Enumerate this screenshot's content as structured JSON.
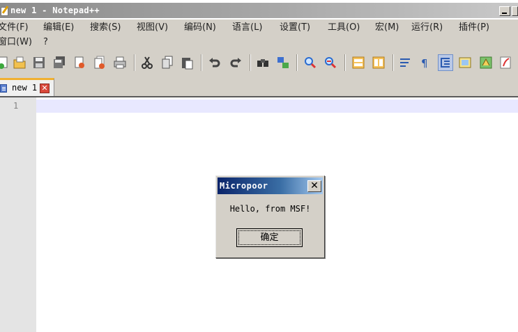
{
  "window": {
    "title": "new 1 - Notepad++"
  },
  "menu": {
    "row1": [
      "文件(F)",
      "编辑(E)",
      "搜索(S)",
      "视图(V)",
      "编码(N)",
      "语言(L)",
      "设置(T)",
      "工具(O)",
      "宏(M)",
      "运行(R)",
      "插件(P)"
    ],
    "row2": [
      "窗口(W)",
      "?"
    ]
  },
  "toolbar": {
    "icons": [
      "new-file-icon",
      "open-file-icon",
      "save-icon",
      "save-all-icon",
      "close-icon",
      "close-all-icon",
      "print-icon",
      "cut-icon",
      "copy-icon",
      "paste-icon",
      "undo-icon",
      "redo-icon",
      "find-icon",
      "replace-icon",
      "zoom-in-icon",
      "zoom-out-icon",
      "sync-vertical-icon",
      "sync-horizontal-icon",
      "word-wrap-icon",
      "show-all-chars-icon",
      "indent-guide-icon",
      "doc-map-icon",
      "function-list-icon",
      "folder-as-workspace-icon"
    ]
  },
  "tabs": [
    {
      "label": "new 1",
      "close": "✕"
    }
  ],
  "editor": {
    "line_numbers": [
      "1"
    ],
    "content": ""
  },
  "dialog": {
    "title": "Micropoor",
    "message": "Hello, from MSF!",
    "ok_label": "确定",
    "close_glyph": "✕"
  },
  "colors": {
    "titlebar": "#a0a0a0",
    "chrome": "#d4d0c8",
    "dialog_title": "#0a246a",
    "current_line": "#e8e8ff",
    "tab_accent": "#f0b030"
  }
}
